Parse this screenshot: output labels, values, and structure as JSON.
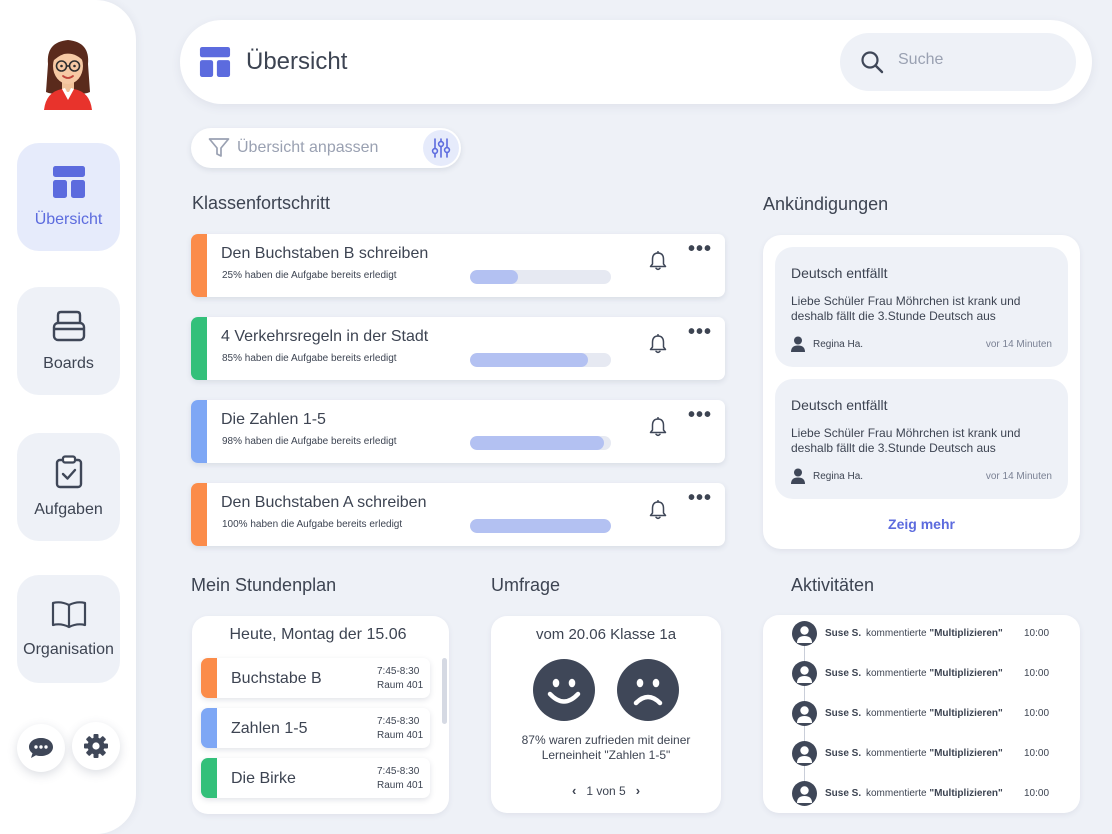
{
  "sidebar": {
    "items": [
      {
        "label": "Übersicht",
        "icon": "dashboard-icon",
        "active": true
      },
      {
        "label": "Boards",
        "icon": "boards-icon"
      },
      {
        "label": "Aufgaben",
        "icon": "clipboard-check-icon"
      },
      {
        "label": "Organisation",
        "icon": "book-icon"
      }
    ],
    "bottom_buttons": [
      "chat-icon",
      "gear-icon"
    ]
  },
  "header": {
    "title": "Übersicht",
    "search_placeholder": "Suche"
  },
  "filter": {
    "label": "Übersicht anpassen"
  },
  "progress": {
    "title": "Klassenfortschritt",
    "items": [
      {
        "title": "Den Buchstaben B schreiben",
        "subtitle": "25% haben die Aufgabe bereits erledigt",
        "percent": 0.34,
        "color": "#fb8c4a",
        "dots": "•••"
      },
      {
        "title": "4 Verkehrsregeln in der Stadt",
        "subtitle": "85% haben die Aufgabe bereits erledigt",
        "percent": 0.84,
        "color": "#33c07a",
        "dots": "•••"
      },
      {
        "title": "Die Zahlen 1-5",
        "subtitle": "98% haben die Aufgabe bereits erledigt",
        "percent": 0.95,
        "color": "#7ea7f5",
        "dots": "•••"
      },
      {
        "title": "Den Buchstaben A schreiben",
        "subtitle": "100% haben die Aufgabe bereits erledigt",
        "percent": 1.0,
        "color": "#fb8c4a",
        "dots": "•••"
      }
    ]
  },
  "announcements": {
    "title": "Ankündigungen",
    "items": [
      {
        "title": "Deutsch entfällt",
        "body": "Liebe Schüler Frau Möhrchen ist krank und deshalb fällt die 3.Stunde Deutsch aus",
        "author": "Regina Ha.",
        "time": "vor 14 Minuten"
      },
      {
        "title": "Deutsch entfällt",
        "body": "Liebe Schüler Frau Möhrchen ist krank und deshalb fällt die 3.Stunde Deutsch aus",
        "author": "Regina Ha.",
        "time": "vor 14 Minuten"
      }
    ],
    "more": "Zeig mehr"
  },
  "schedule": {
    "title": "Mein Stundenplan",
    "header": "Heute, Montag der 15.06",
    "items": [
      {
        "name": "Buchstabe B",
        "time": "7:45-8:30",
        "room": "Raum 401",
        "color": "#fb8c4a"
      },
      {
        "name": "Zahlen 1-5",
        "time": "7:45-8:30",
        "room": "Raum 401",
        "color": "#7ea7f5"
      },
      {
        "name": "Die Birke",
        "time": "7:45-8:30",
        "room": "Raum 401",
        "color": "#33c07a"
      }
    ]
  },
  "survey": {
    "title": "Umfrage",
    "header": "vom 20.06 Klasse 1a",
    "text": "87% waren zufrieden mit deiner Lerneinheit \"Zahlen 1-5\"",
    "pager": "1 von 5",
    "prev": "‹",
    "next": "›"
  },
  "activities": {
    "title": "Aktivitäten",
    "items": [
      {
        "name": "Suse S.",
        "verb": "kommentierte",
        "object": "\"Multiplizieren\"",
        "time": "10:00"
      },
      {
        "name": "Suse S.",
        "verb": "kommentierte",
        "object": "\"Multiplizieren\"",
        "time": "10:00"
      },
      {
        "name": "Suse S.",
        "verb": "kommentierte",
        "object": "\"Multiplizieren\"",
        "time": "10:00"
      },
      {
        "name": "Suse S.",
        "verb": "kommentierte",
        "object": "\"Multiplizieren\"",
        "time": "10:00"
      },
      {
        "name": "Suse S.",
        "verb": "kommentierte",
        "object": "\"Multiplizieren\"",
        "time": "10:00"
      }
    ]
  },
  "colors": {
    "accent": "#5c6bde",
    "bar_fill": "#b3c1f2",
    "background": "#eef1f7"
  }
}
